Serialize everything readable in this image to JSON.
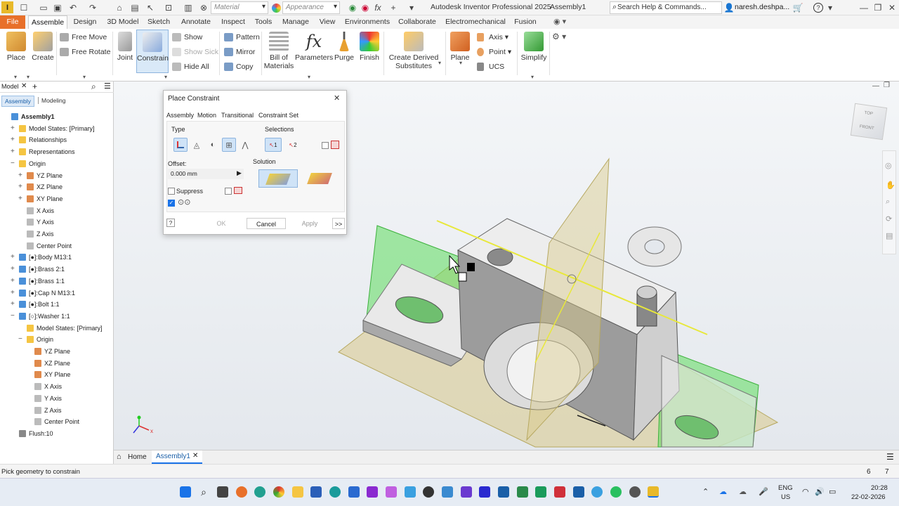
{
  "app_title": "Autodesk Inventor Professional 2025",
  "doc_title": "Assembly1",
  "search_placeholder": "Search Help & Commands...",
  "user_name": "naresh.deshpa...",
  "material_combo": "Material",
  "appearance_combo": "Appearance",
  "menu_tabs": [
    "File",
    "Assemble",
    "Design",
    "3D Model",
    "Sketch",
    "Annotate",
    "Inspect",
    "Tools",
    "Manage",
    "View",
    "Environments",
    "Collaborate",
    "Electromechanical",
    "Fusion"
  ],
  "ribbon": {
    "place": "Place",
    "create": "Create",
    "free_move": "Free Move",
    "free_rotate": "Free Rotate",
    "joint": "Joint",
    "constrain": "Constrain",
    "show": "Show",
    "show_sick": "Show Sick",
    "hide_all": "Hide All",
    "pattern": "Pattern",
    "mirror": "Mirror",
    "copy": "Copy",
    "bill_of_materials_1": "Bill of",
    "bill_of_materials_2": "Materials",
    "parameters": "Parameters",
    "purge": "Purge",
    "finish": "Finish",
    "create_derived_1": "Create Derived",
    "create_derived_2": "Substitutes",
    "plane": "Plane",
    "axis": "Axis",
    "point": "Point",
    "ucs": "UCS",
    "simplify": "Simplify"
  },
  "browser": {
    "tab_model": "Model",
    "sub_assembly": "Assembly",
    "sub_modeling": "Modeling",
    "tree": [
      {
        "label": "Assembly1",
        "indent": 0,
        "exp": "",
        "bold": true,
        "color": "#4a90d9"
      },
      {
        "label": "Model States: [Primary]",
        "indent": 1,
        "exp": "+",
        "color": "#f5c542"
      },
      {
        "label": "Relationships",
        "indent": 1,
        "exp": "+",
        "color": "#f5c542"
      },
      {
        "label": "Representations",
        "indent": 1,
        "exp": "+",
        "color": "#f5c542"
      },
      {
        "label": "Origin",
        "indent": 1,
        "exp": "−",
        "color": "#f5c542"
      },
      {
        "label": "YZ Plane",
        "indent": 2,
        "exp": "+",
        "color": "#e08a4c"
      },
      {
        "label": "XZ Plane",
        "indent": 2,
        "exp": "+",
        "color": "#e08a4c"
      },
      {
        "label": "XY Plane",
        "indent": 2,
        "exp": "+",
        "color": "#e08a4c"
      },
      {
        "label": "X Axis",
        "indent": 2,
        "exp": "",
        "color": "#bbbbbb"
      },
      {
        "label": "Y Axis",
        "indent": 2,
        "exp": "",
        "color": "#bbbbbb"
      },
      {
        "label": "Z Axis",
        "indent": 2,
        "exp": "",
        "color": "#bbbbbb"
      },
      {
        "label": "Center Point",
        "indent": 2,
        "exp": "",
        "color": "#bbbbbb"
      },
      {
        "label": "[●]:Body M13:1",
        "indent": 1,
        "exp": "+",
        "color": "#4a90d9"
      },
      {
        "label": "[●]:Brass 2:1",
        "indent": 1,
        "exp": "+",
        "color": "#4a90d9"
      },
      {
        "label": "[●]:Brass 1:1",
        "indent": 1,
        "exp": "+",
        "color": "#4a90d9"
      },
      {
        "label": "[●]:Cap N M13:1",
        "indent": 1,
        "exp": "+",
        "color": "#4a90d9"
      },
      {
        "label": "[●]:Bolt 1:1",
        "indent": 1,
        "exp": "+",
        "color": "#4a90d9"
      },
      {
        "label": "[○]:Washer 1:1",
        "indent": 1,
        "exp": "−",
        "color": "#4a90d9"
      },
      {
        "label": "Model States: [Primary]",
        "indent": 2,
        "exp": "",
        "color": "#f5c542"
      },
      {
        "label": "Origin",
        "indent": 2,
        "exp": "−",
        "color": "#f5c542"
      },
      {
        "label": "YZ Plane",
        "indent": 3,
        "exp": "",
        "color": "#e08a4c"
      },
      {
        "label": "XZ Plane",
        "indent": 3,
        "exp": "",
        "color": "#e08a4c"
      },
      {
        "label": "XY Plane",
        "indent": 3,
        "exp": "",
        "color": "#e08a4c"
      },
      {
        "label": "X Axis",
        "indent": 3,
        "exp": "",
        "color": "#bbbbbb"
      },
      {
        "label": "Y Axis",
        "indent": 3,
        "exp": "",
        "color": "#bbbbbb"
      },
      {
        "label": "Z Axis",
        "indent": 3,
        "exp": "",
        "color": "#bbbbbb"
      },
      {
        "label": "Center Point",
        "indent": 3,
        "exp": "",
        "color": "#bbbbbb"
      },
      {
        "label": "Flush:10",
        "indent": 1,
        "exp": "",
        "color": "#888888"
      }
    ]
  },
  "dialog": {
    "title": "Place Constraint",
    "tabs": [
      "Assembly",
      "Motion",
      "Transitional",
      "Constraint Set"
    ],
    "type_label": "Type",
    "selections_label": "Selections",
    "offset_label": "Offset:",
    "offset_value": "0.000 mm",
    "solution_label": "Solution",
    "suppress_label": "Suppress",
    "sel1": "1",
    "sel2": "2",
    "ok": "OK",
    "cancel": "Cancel",
    "apply": "Apply",
    "more": ">>"
  },
  "viewcube": {
    "top": "TOP",
    "front": "FRONT"
  },
  "doc_tabs": {
    "home": "Home",
    "assembly": "Assembly1"
  },
  "status": {
    "message": "Pick geometry to constrain",
    "count1": "6",
    "count2": "7"
  },
  "taskbar": {
    "lang1": "ENG",
    "lang2": "US",
    "time": "20:28",
    "date": "22-02-2026"
  },
  "colors": {
    "accent": "#e8702a",
    "select": "#cfe3f7",
    "green_plane": "#5ddc5d"
  }
}
